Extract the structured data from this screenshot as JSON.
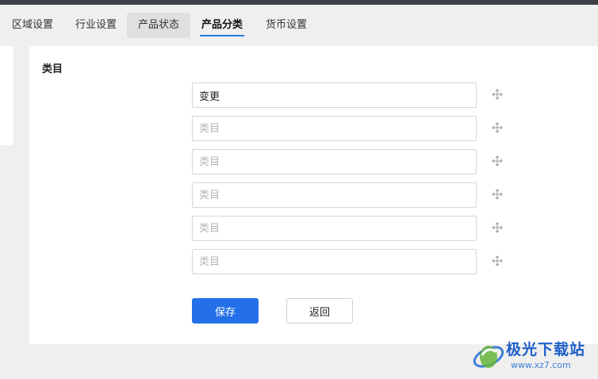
{
  "tabs": [
    {
      "label": "区域设置"
    },
    {
      "label": "行业设置"
    },
    {
      "label": "产品状态"
    },
    {
      "label": "产品分类"
    },
    {
      "label": "货币设置"
    }
  ],
  "active_tab": "产品分类",
  "form": {
    "section_title": "类目",
    "fields": [
      {
        "value": "变更",
        "placeholder": "类目"
      },
      {
        "value": "",
        "placeholder": "类目"
      },
      {
        "value": "",
        "placeholder": "类目"
      },
      {
        "value": "",
        "placeholder": "类目"
      },
      {
        "value": "",
        "placeholder": "类目"
      },
      {
        "value": "",
        "placeholder": "类目"
      }
    ],
    "drag_icon": "move-handle-icon"
  },
  "buttons": {
    "save_label": "保存",
    "back_label": "返回"
  },
  "colors": {
    "primary": "#2470e8",
    "tab_underline": "#1d7de3",
    "topbar": "#3c3f45"
  },
  "watermark": {
    "title": "极光下载站",
    "url": "www.xz7.com"
  }
}
